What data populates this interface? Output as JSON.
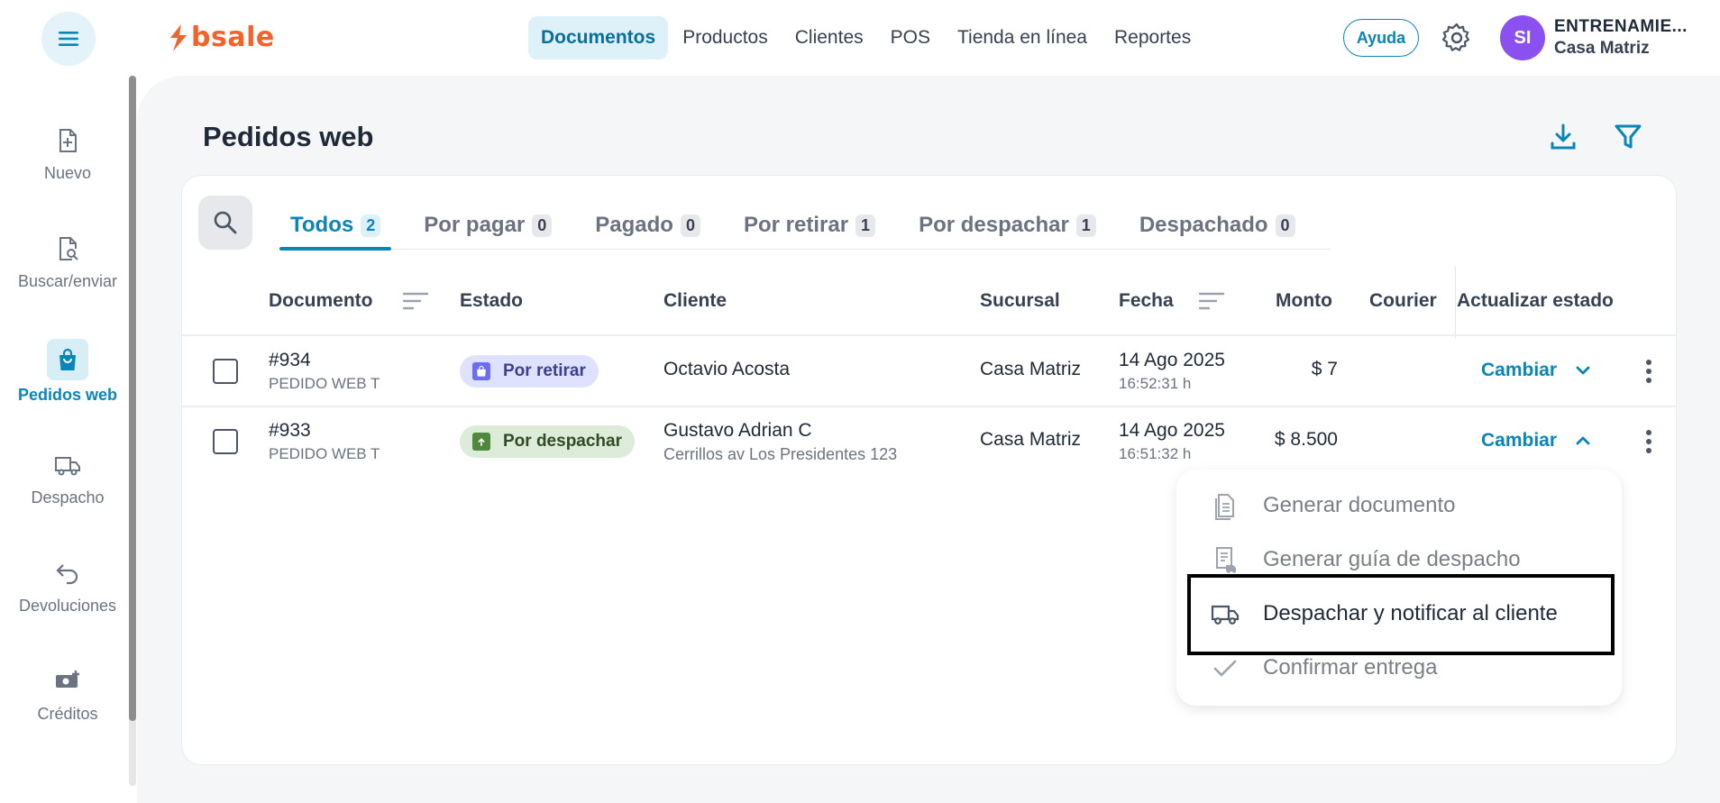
{
  "sidebar": {
    "items": [
      {
        "label": "Nuevo",
        "icon": "file-plus-icon",
        "active": false
      },
      {
        "label": "Buscar/enviar",
        "icon": "file-search-icon",
        "active": false
      },
      {
        "label": "Pedidos web",
        "icon": "shopping-bag-icon",
        "active": true
      },
      {
        "label": "Despacho",
        "icon": "truck-icon",
        "active": false
      },
      {
        "label": "Devoluciones",
        "icon": "return-arrow-icon",
        "active": false
      },
      {
        "label": "Créditos",
        "icon": "money-plus-icon",
        "active": false
      }
    ]
  },
  "header": {
    "logo_text": "bsale",
    "nav": [
      {
        "label": "Documentos",
        "active": true
      },
      {
        "label": "Productos",
        "active": false
      },
      {
        "label": "Clientes",
        "active": false
      },
      {
        "label": "POS",
        "active": false
      },
      {
        "label": "Tienda en línea",
        "active": false
      },
      {
        "label": "Reportes",
        "active": false
      }
    ],
    "help_label": "Ayuda",
    "avatar_initials": "SI",
    "user_name": "ENTRENAMIE...",
    "branch": "Casa Matriz"
  },
  "page": {
    "title": "Pedidos web"
  },
  "tabs": [
    {
      "label": "Todos",
      "count": "2",
      "active": true
    },
    {
      "label": "Por pagar",
      "count": "0",
      "active": false
    },
    {
      "label": "Pagado",
      "count": "0",
      "active": false
    },
    {
      "label": "Por retirar",
      "count": "1",
      "active": false
    },
    {
      "label": "Por despachar",
      "count": "1",
      "active": false
    },
    {
      "label": "Despachado",
      "count": "0",
      "active": false
    }
  ],
  "table": {
    "headers": {
      "documento": "Documento",
      "estado": "Estado",
      "cliente": "Cliente",
      "sucursal": "Sucursal",
      "fecha": "Fecha",
      "monto": "Monto",
      "courier": "Courier",
      "actualizar": "Actualizar estado"
    },
    "rows": [
      {
        "doc_num": "#934",
        "doc_type": "PEDIDO WEB T",
        "estado": "Por retirar",
        "cliente": "Octavio Acosta",
        "cliente_sub": "",
        "sucursal": "Casa Matriz",
        "fecha": "14 Ago 2025",
        "hora": "16:52:31 h",
        "monto": "$ 7",
        "courier": "",
        "action": "Cambiar"
      },
      {
        "doc_num": "#933",
        "doc_type": "PEDIDO WEB T",
        "estado": "Por despachar",
        "cliente": "Gustavo Adrian C",
        "cliente_sub": "Cerrillos av Los Presidentes 123",
        "sucursal": "Casa Matriz",
        "fecha": "14 Ago 2025",
        "hora": "16:51:32 h",
        "monto": "$ 8.500",
        "courier": "",
        "action": "Cambiar"
      }
    ]
  },
  "dropdown": {
    "items": [
      {
        "label": "Generar documento",
        "icon": "document-icon",
        "enabled": false
      },
      {
        "label": "Generar guía de despacho",
        "icon": "dispatch-guide-icon",
        "enabled": false
      },
      {
        "label": "Despachar y notificar al cliente",
        "icon": "truck-icon",
        "enabled": true
      },
      {
        "label": "Confirmar entrega",
        "icon": "check-icon",
        "enabled": false
      }
    ]
  },
  "colors": {
    "accent": "#0a85b9",
    "brand": "#f2622b",
    "avatar": "#8b50f0"
  }
}
